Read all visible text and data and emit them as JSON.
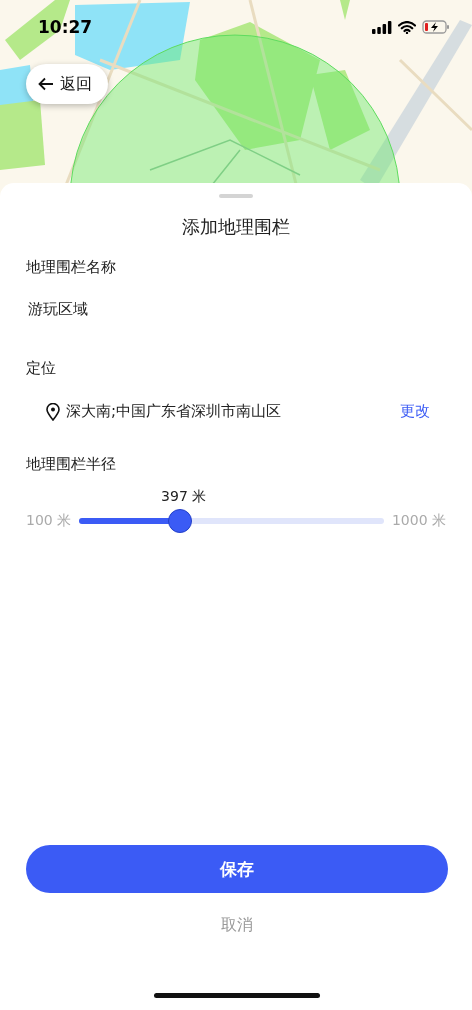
{
  "status_bar": {
    "time": "10:27"
  },
  "back_button": {
    "label": "返回"
  },
  "sheet": {
    "title": "添加地理围栏",
    "name_field": {
      "label": "地理围栏名称",
      "value": "游玩区域"
    },
    "location": {
      "label": "定位",
      "address": "深大南;中国广东省深圳市南山区",
      "change_link": "更改"
    },
    "radius": {
      "label": "地理围栏半径",
      "reading": "397 米",
      "min_label": "100 米",
      "max_label": "1000 米",
      "level": 0.33
    }
  },
  "buttons": [
    {
      "label": "保存",
      "kind": "primary"
    },
    {
      "label": "取消",
      "kind": "text"
    }
  ]
}
